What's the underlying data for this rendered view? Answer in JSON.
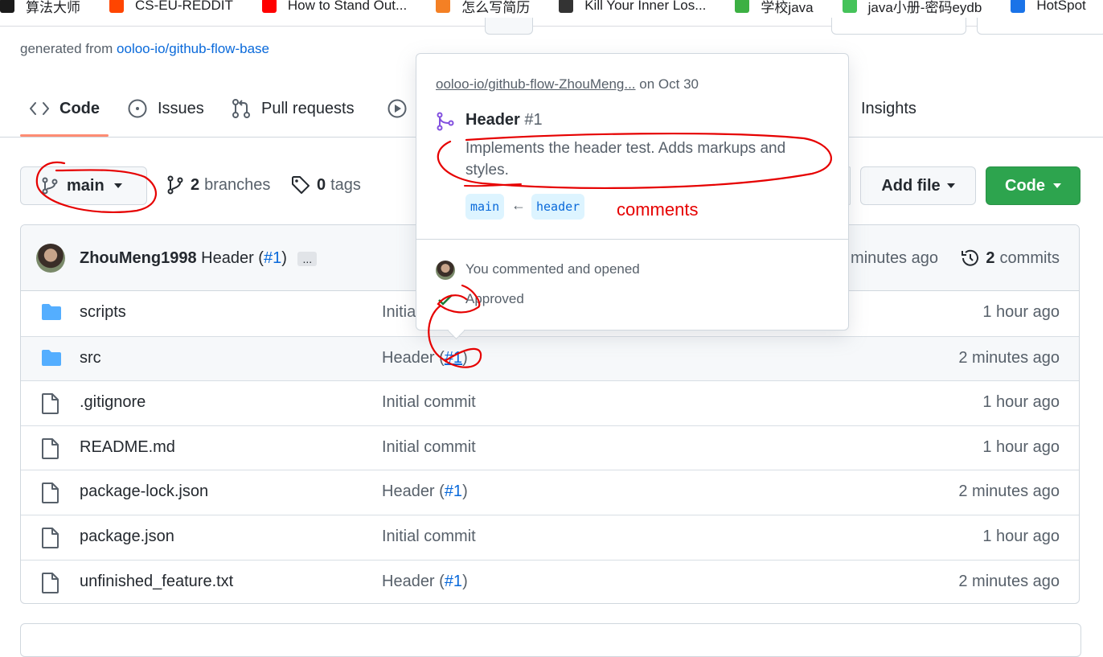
{
  "bookmarks": [
    {
      "label": "算法大师",
      "icon": "x-logo-icon",
      "color": "#1b1b1b"
    },
    {
      "label": "CS-EU-REDDIT",
      "icon": "reddit-icon",
      "color": "#ff4500"
    },
    {
      "label": "How to Stand Out...",
      "icon": "youtube-icon",
      "color": "#ff0000"
    },
    {
      "label": "怎么写简历",
      "icon": "stack-overflow-icon",
      "color": "#f48024"
    },
    {
      "label": "Kill Your Inner Los...",
      "icon": "bookmark-thumb-icon",
      "color": "#333333"
    },
    {
      "label": "学校java",
      "icon": "green-leaf-icon",
      "color": "#3cb043"
    },
    {
      "label": "java小册-密码eydb",
      "icon": "green-swoosh-icon",
      "color": "#45c35a"
    },
    {
      "label": "HotSpot",
      "icon": "wifi-icon",
      "color": "#1a73e8"
    }
  ],
  "repo": {
    "generated_prefix": "generated from",
    "template_link": "ooloo-io/github-flow-base"
  },
  "tabs": [
    {
      "label": "Code",
      "icon": "code-icon",
      "active": true
    },
    {
      "label": "Issues",
      "icon": "issue-icon"
    },
    {
      "label": "Pull requests",
      "icon": "pull-request-icon"
    },
    {
      "label": "",
      "icon": "actions-play-icon"
    },
    {
      "label": "Insights",
      "icon": "graph-icon"
    }
  ],
  "branch_bar": {
    "branch": "main",
    "branches_count": "2",
    "branches_label": "branches",
    "tags_count": "0",
    "tags_label": "tags",
    "add_file": "Add file",
    "code": "Code"
  },
  "latest_commit": {
    "author": "ZhouMeng1998",
    "message": "Header (",
    "pr_link": "#1",
    "message_end": ")",
    "ellipsis": "...",
    "time": "minutes ago",
    "commits_count": "2",
    "commits_label": "commits"
  },
  "files": [
    {
      "type": "folder",
      "name": "scripts",
      "message": "Initial commit",
      "pr": "",
      "time": "1 hour ago"
    },
    {
      "type": "folder",
      "name": "src",
      "message": "Header (",
      "pr": "#1",
      "time": "2 minutes ago"
    },
    {
      "type": "file",
      "name": ".gitignore",
      "message": "Initial commit",
      "pr": "",
      "time": "1 hour ago"
    },
    {
      "type": "file",
      "name": "README.md",
      "message": "Initial commit",
      "pr": "",
      "time": "1 hour ago"
    },
    {
      "type": "file",
      "name": "package-lock.json",
      "message": "Header (",
      "pr": "#1",
      "time": "2 minutes ago"
    },
    {
      "type": "file",
      "name": "package.json",
      "message": "Initial commit",
      "pr": "",
      "time": "1 hour ago"
    },
    {
      "type": "file",
      "name": "unfinished_feature.txt",
      "message": "Header (",
      "pr": "#1",
      "time": "2 minutes ago"
    }
  ],
  "popover": {
    "repo_link": "ooloo-io/github-flow-ZhouMeng...",
    "repo_date": "on Oct 30",
    "pr_title": "Header",
    "pr_number": "#1",
    "description": "Implements the header test. Adds markups and styles.",
    "base_branch": "main",
    "arrow": "←",
    "head_branch": "header",
    "activity_1": "You commented and opened",
    "activity_2": "Approved"
  },
  "annotation": {
    "label": "comments",
    "color": "#e60000"
  }
}
